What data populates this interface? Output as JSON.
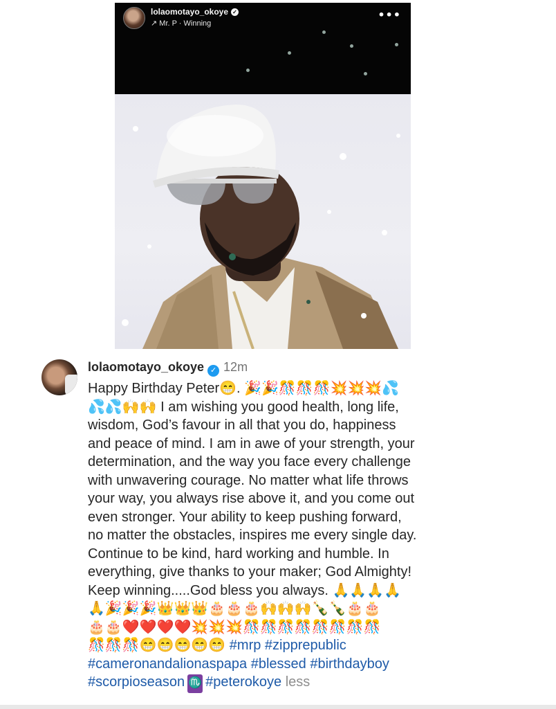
{
  "post": {
    "username": "lolaomotayo_okoye",
    "audio": "Mr. P · Winning",
    "more": "•••"
  },
  "comment": {
    "username": "lolaomotayo_okoye",
    "time": "12m",
    "lines": [
      "Happy Birthday Peter😁. 🎉🎉🎊🎊🎊💥💥💥💦",
      "💦💦🙌🙌 I am wishing you good health, long life,",
      "wisdom, God’s favour in all that you do, happiness",
      "and peace of mind. I am in awe of your strength, your",
      "determination, and the way you face every challenge",
      "with unwavering courage. No matter what life throws",
      "your way, you always rise above it, and you come out",
      "even stronger. Your ability to keep pushing forward,",
      "no matter the obstacles, inspires me every single day.",
      "Continue to be kind, hard working and humble. In",
      "everything, give thanks to your maker; God Almighty!",
      "Keep winning.....God bless you always. 🙏🙏🙏🙏",
      "🙏🎉🎉🎉👑👑👑🎂🎂🎂🙌🙌🙌🍾🍾🎂🎂",
      "🎂🎂❤️❤️❤️❤️💥💥💥🎊🎊🎊🎊🎊🎊🎊🎊",
      "🎊🎊🎊😁😁😁😁😁"
    ],
    "hashtags_line13": "#mrp #zipprepublic",
    "hashtags_line14": "#cameronandalionaspapa #blessed #birthdayboy",
    "hashtags_line15a": "#scorpioseason",
    "scorpio_emoji": "♏",
    "hashtags_line15b": "#peterokoye",
    "less_label": "less"
  }
}
